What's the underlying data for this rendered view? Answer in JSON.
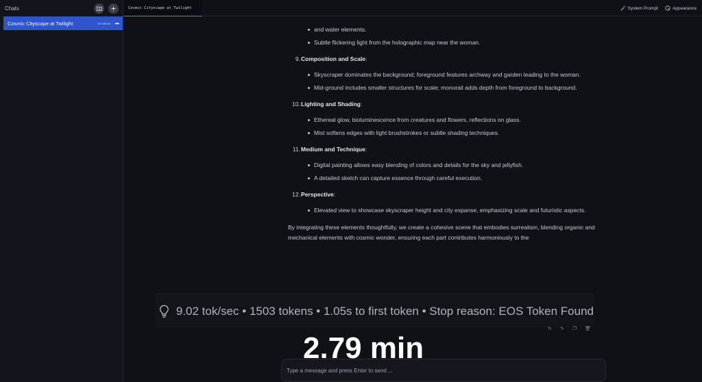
{
  "sidebar": {
    "title": "Chats",
    "new_folder_icon": "folder-plus-icon",
    "new_chat_icon": "plus-icon",
    "chats": [
      {
        "title": "Cosmic Cityscape at Twilight",
        "meta": "15 tokens"
      }
    ]
  },
  "tabs": [
    {
      "label": "Cosmic Cityscape at Twilight"
    }
  ],
  "top_actions": {
    "system_prompt": "System Prompt",
    "appearance": "Appearance"
  },
  "content": {
    "top_bullets": [
      "and water elements.",
      "Subtle flickering light from the holographic map near the woman."
    ],
    "sections": [
      {
        "num": "9.",
        "title": "Composition and Scale",
        "colon": ":",
        "bullets": [
          "Skyscraper dominates the background; foreground features archway and garden leading to the woman.",
          "Mid-ground includes smaller structures for scale; monorail adds depth from foreground to background."
        ]
      },
      {
        "num": "10.",
        "title": "Lighting and Shading",
        "colon": ":",
        "bullets": [
          "Ethereal glow, bioluminescence from creatures and flowers, reflections on glass.",
          "Mist softens edges with light brushstrokes or subtle shading techniques."
        ]
      },
      {
        "num": "11.",
        "title": "Medium and Technique",
        "colon": ":",
        "bullets": [
          "Digital painting allows easy blending of colors and details for the sky and jellyfish.",
          "A detailed sketch can capture essence through careful execution."
        ]
      },
      {
        "num": "12.",
        "title": "Perspective",
        "colon": ":",
        "bullets": [
          "Elevated view to showcase skyscraper height and city expanse, emphasizing scale and futuristic aspects."
        ]
      }
    ],
    "closing": "By integrating these elements thoughtfully, we create a cohesive scene that embodies surrealism, blending organic and mechanical elements with cosmic wonder, ensuring each part contributes harmoniously to the"
  },
  "stats": {
    "icon": "lightbulb-icon",
    "text": "9.02 tok/sec • 1503 tokens • 1.05s to first token • Stop reason: EOS Token Found"
  },
  "timer": "2.79 min",
  "composer": {
    "placeholder": "Type a message and press Enter to send ..."
  }
}
